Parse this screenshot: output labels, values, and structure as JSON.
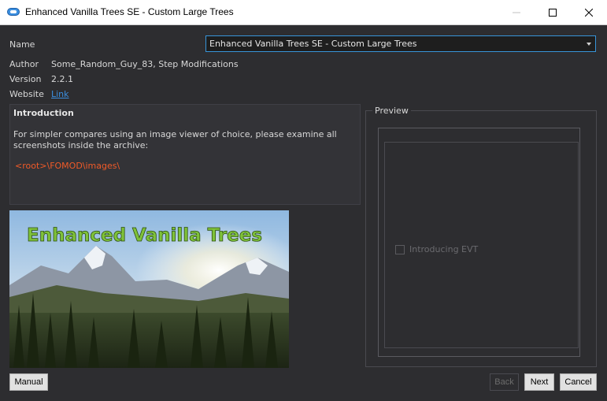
{
  "window": {
    "title": "Enhanced Vanilla Trees SE - Custom Large Trees",
    "minimize_icon": "minimize-icon",
    "maximize_icon": "maximize-icon",
    "close_icon": "close-icon"
  },
  "fields": {
    "name_label": "Name",
    "name_value": "Enhanced Vanilla Trees SE - Custom Large Trees",
    "author_label": "Author",
    "author_value": "Some_Random_Guy_83, Step Modifications",
    "version_label": "Version",
    "version_value": "2.2.1",
    "website_label": "Website",
    "website_link": "Link"
  },
  "intro": {
    "heading": "Introduction",
    "body": "For simpler compares using an image viewer of choice, please examine all screenshots inside the archive:",
    "path": "<root>\\FOMOD\\images\\"
  },
  "image": {
    "banner_text": "Enhanced Vanilla Trees"
  },
  "preview": {
    "legend": "Preview",
    "option_label": "Introducing EVT"
  },
  "buttons": {
    "manual": "Manual",
    "back": "Back",
    "next": "Next",
    "cancel": "Cancel"
  },
  "colors": {
    "accent": "#3794d9",
    "path_text": "#f05a28",
    "link": "#3b8fe0",
    "background": "#2d2d30"
  }
}
